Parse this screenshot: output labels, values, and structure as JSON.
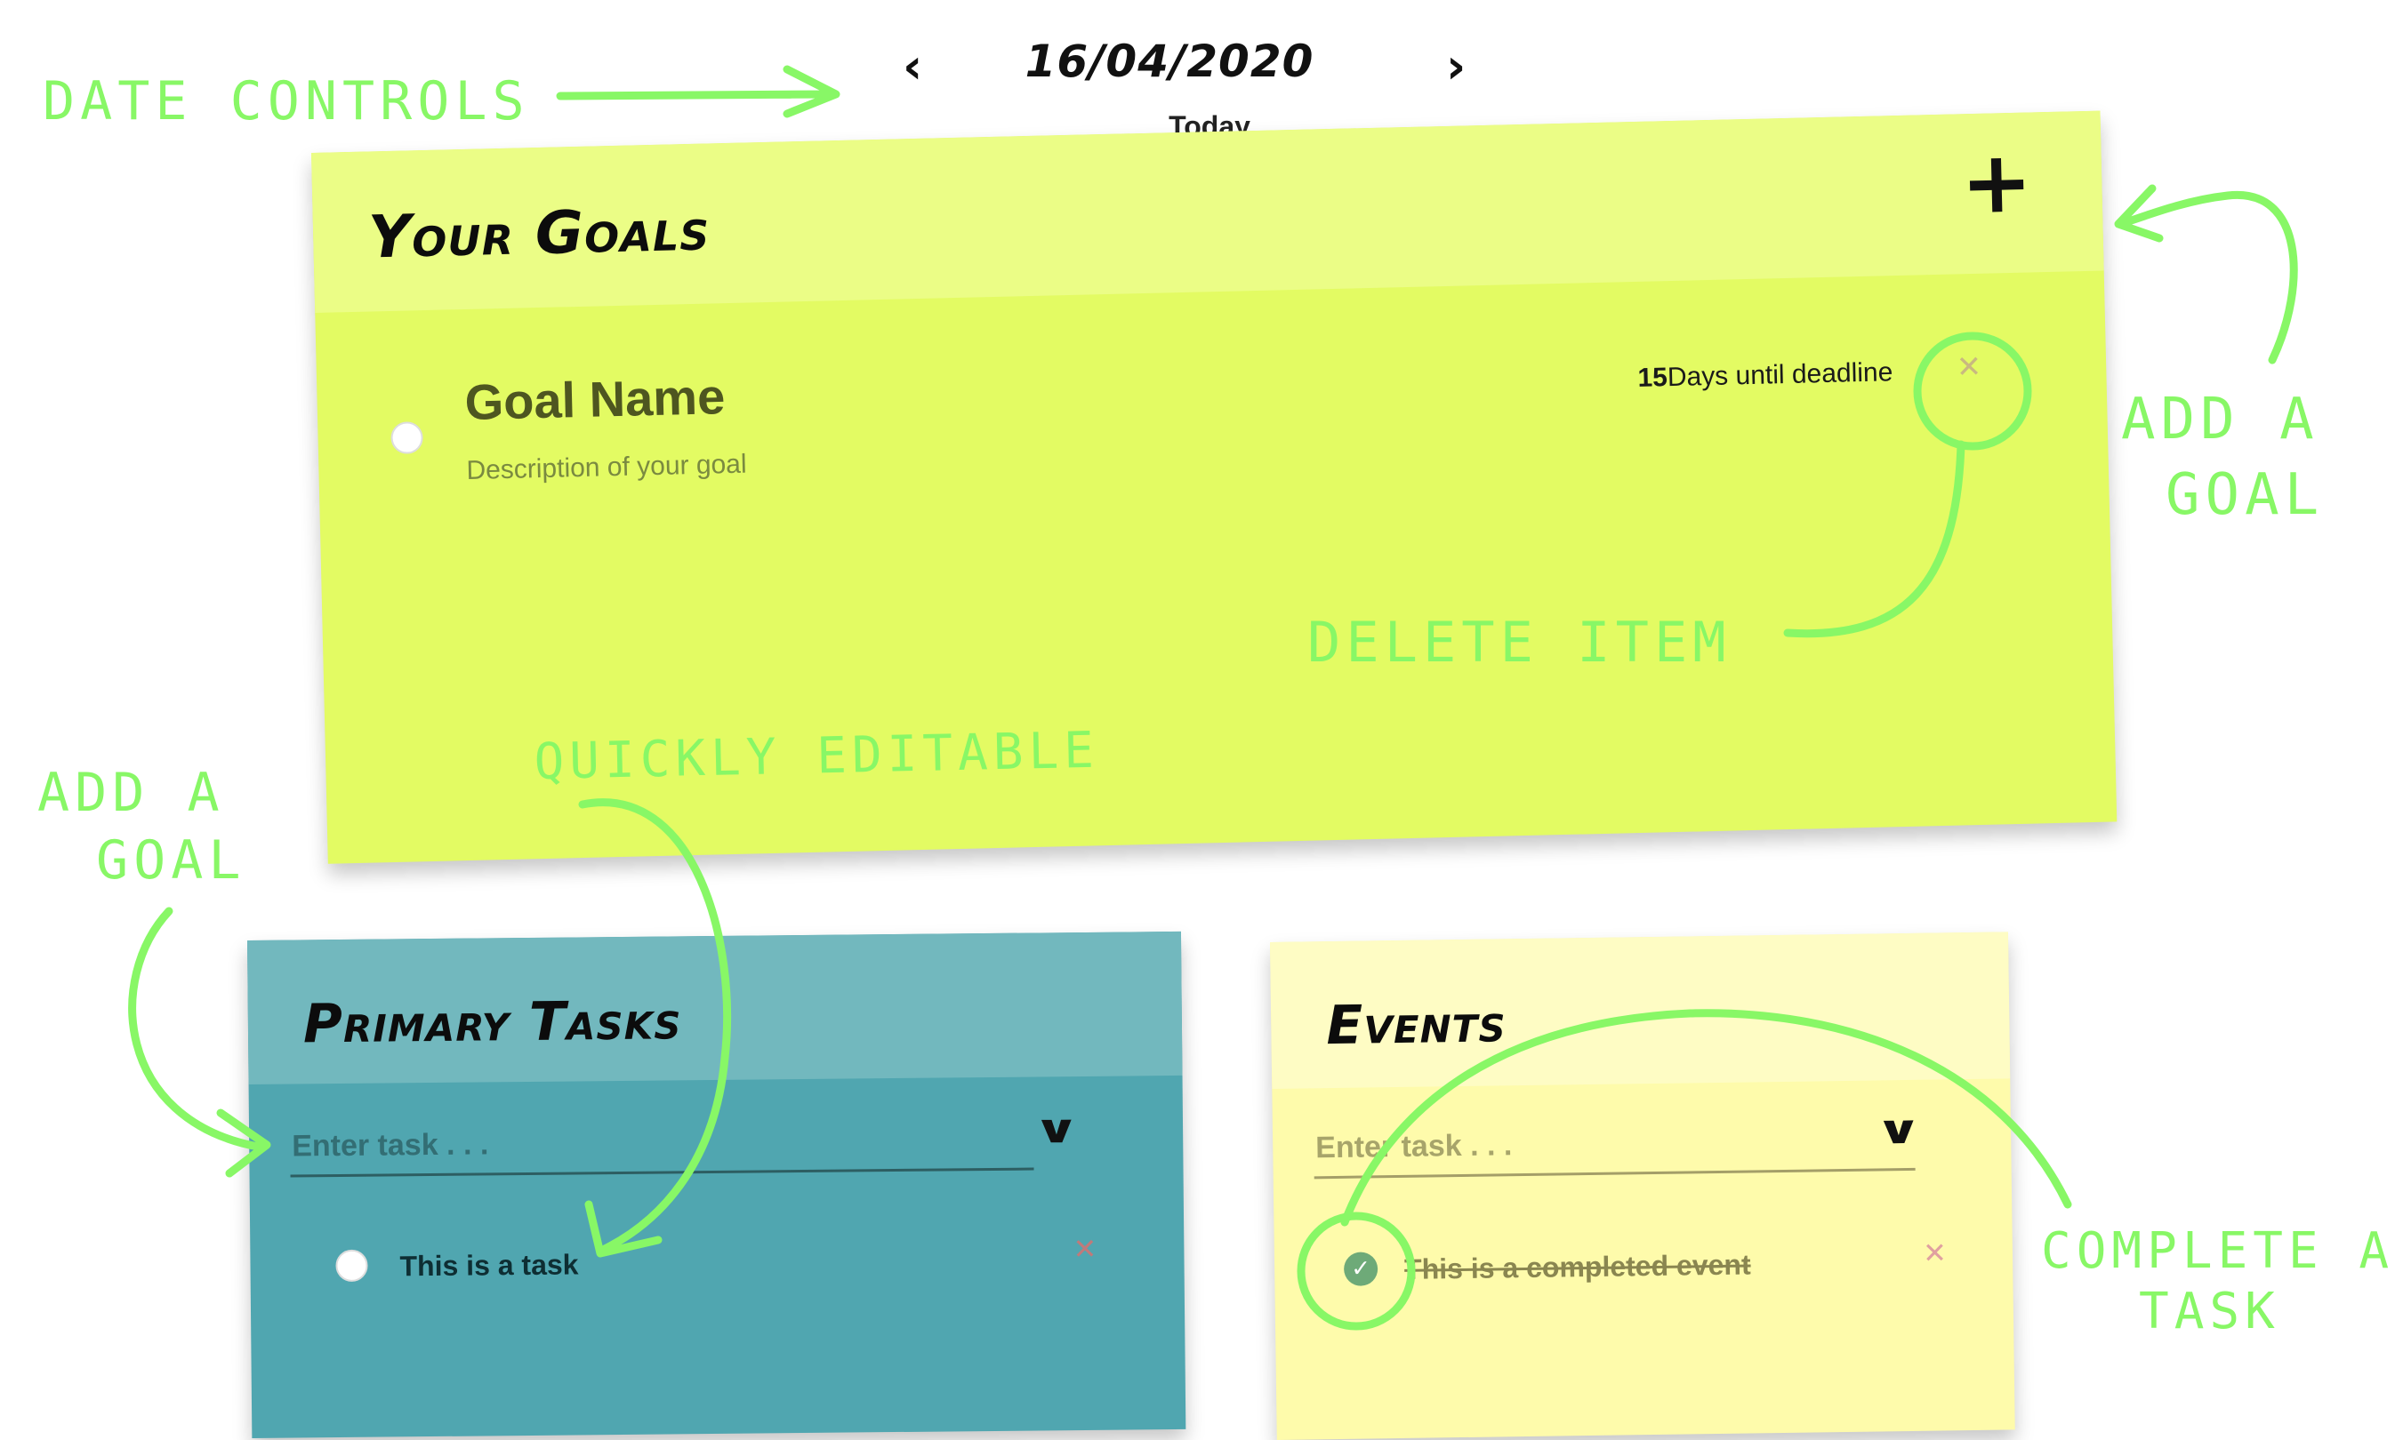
{
  "date_controls": {
    "date": "16/04/2020",
    "subtitle": "Today"
  },
  "goals_note": {
    "title": "Your Goals",
    "goal": {
      "name": "Goal Name",
      "description": "Description of your goal",
      "deadline_number": "15",
      "deadline_text": "Days until deadline"
    }
  },
  "tasks_note": {
    "title": "Primary Tasks",
    "input_placeholder": "Enter task . . .",
    "task_text": "This is a task"
  },
  "events_note": {
    "title": "Events",
    "input_placeholder": "Enter task . . .",
    "event_text": "This is a completed event"
  },
  "annotations": {
    "date_controls": "DATE CONTROLS",
    "add_goal_right_line1": "ADD A",
    "add_goal_right_line2": "GOAL",
    "delete_item": "DELETE ITEM",
    "quickly_editable": "QUICKLY EDITABLE",
    "add_goal_left_line1": "ADD A",
    "add_goal_left_line2": "GOAL",
    "complete_task_line1": "COMPLETE A",
    "complete_task_line2": "TASK"
  },
  "colors": {
    "goals_note": "#e3fb63",
    "tasks_note": "#50a6b0",
    "events_note": "#fefbab",
    "annotation_ink": "#88f766"
  },
  "icons": [
    "chevron-left-icon",
    "chevron-right-icon",
    "plus-icon",
    "close-icon",
    "chevron-down-icon",
    "check-icon"
  ]
}
